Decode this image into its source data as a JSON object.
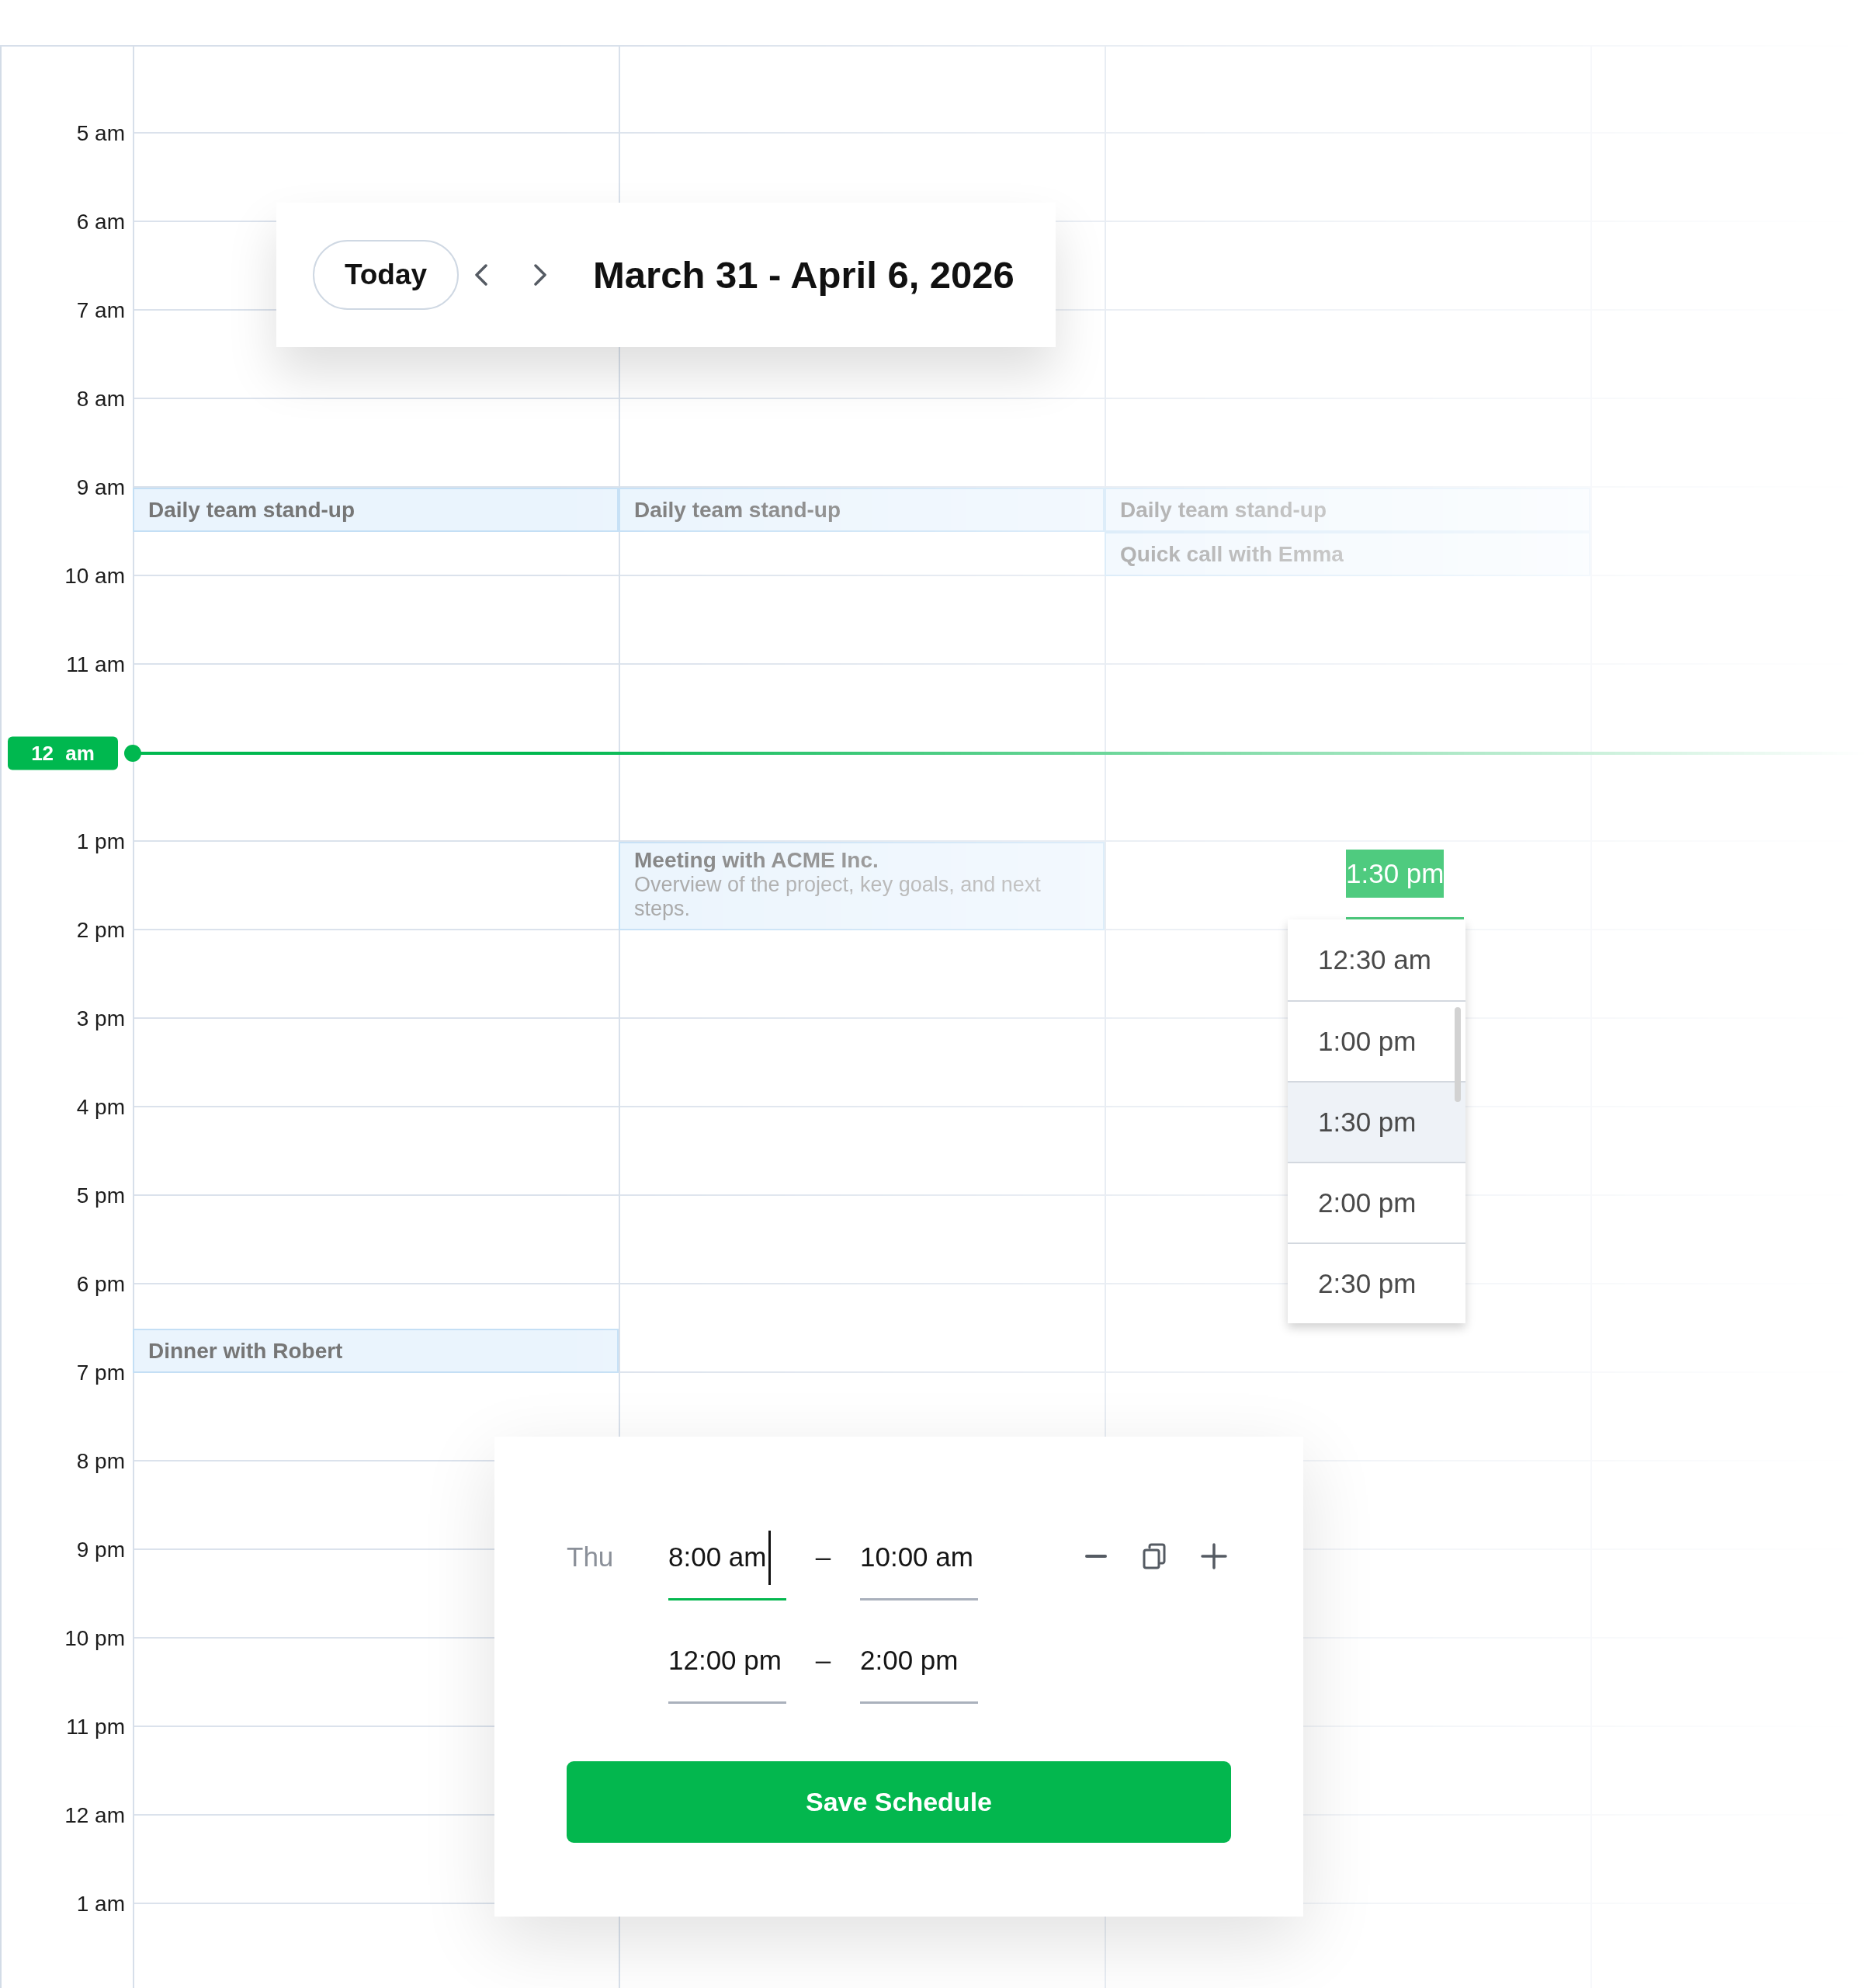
{
  "header": {
    "today_button": "Today",
    "title": "March 31 - April 6, 2026"
  },
  "time_axis": [
    {
      "kind": "hour",
      "label": "5 am"
    },
    {
      "kind": "hour",
      "label": "6 am"
    },
    {
      "kind": "hour",
      "label": "7 am"
    },
    {
      "kind": "hour",
      "label": "8 am"
    },
    {
      "kind": "hour",
      "label": "9 am"
    },
    {
      "kind": "hour",
      "label": "10 am"
    },
    {
      "kind": "hour",
      "label": "11 am"
    },
    {
      "kind": "now",
      "label": "12 am"
    },
    {
      "kind": "hour",
      "label": "1 pm"
    },
    {
      "kind": "hour",
      "label": "2 pm"
    },
    {
      "kind": "hour",
      "label": "3 pm"
    },
    {
      "kind": "hour",
      "label": "4 pm"
    },
    {
      "kind": "hour",
      "label": "5 pm"
    },
    {
      "kind": "hour",
      "label": "6 pm"
    },
    {
      "kind": "hour",
      "label": "7 pm"
    },
    {
      "kind": "hour",
      "label": "8 pm"
    },
    {
      "kind": "hour",
      "label": "9 pm"
    },
    {
      "kind": "hour",
      "label": "10 pm"
    },
    {
      "kind": "hour",
      "label": "11 pm"
    },
    {
      "kind": "hour",
      "label": "12 am"
    },
    {
      "kind": "hour",
      "label": "1 am"
    }
  ],
  "days": [
    {
      "events": [
        {
          "title": "Daily team stand-up"
        },
        {
          "title": "Dinner with Robert"
        }
      ]
    },
    {
      "events": [
        {
          "title": "Daily team stand-up"
        },
        {
          "title": "Meeting with ACME Inc.",
          "description": "Overview of the project, key goals, and next steps."
        }
      ]
    },
    {
      "events": [
        {
          "title": "Daily team stand-up"
        },
        {
          "title": "Quick call with Emma"
        }
      ]
    }
  ],
  "time_picker": {
    "value": "1:30 pm",
    "focused": true,
    "text_selected": true,
    "options": [
      {
        "label": "12:30 am",
        "selected": false
      },
      {
        "label": "1:00 pm",
        "selected": false
      },
      {
        "label": "1:30 pm",
        "selected": true
      },
      {
        "label": "2:00 pm",
        "selected": false
      },
      {
        "label": "2:30 pm",
        "selected": false
      }
    ]
  },
  "schedule_panel": {
    "day": "Thu",
    "slots": [
      {
        "start": {
          "value": "8:00 am",
          "focused": true
        },
        "separator": "–",
        "end": {
          "value": "10:00 am",
          "focused": false
        }
      },
      {
        "start": {
          "value": "12:00 pm",
          "focused": false
        },
        "separator": "–",
        "end": {
          "value": "2:00 pm",
          "focused": false
        }
      }
    ],
    "save_button": "Save Schedule"
  }
}
